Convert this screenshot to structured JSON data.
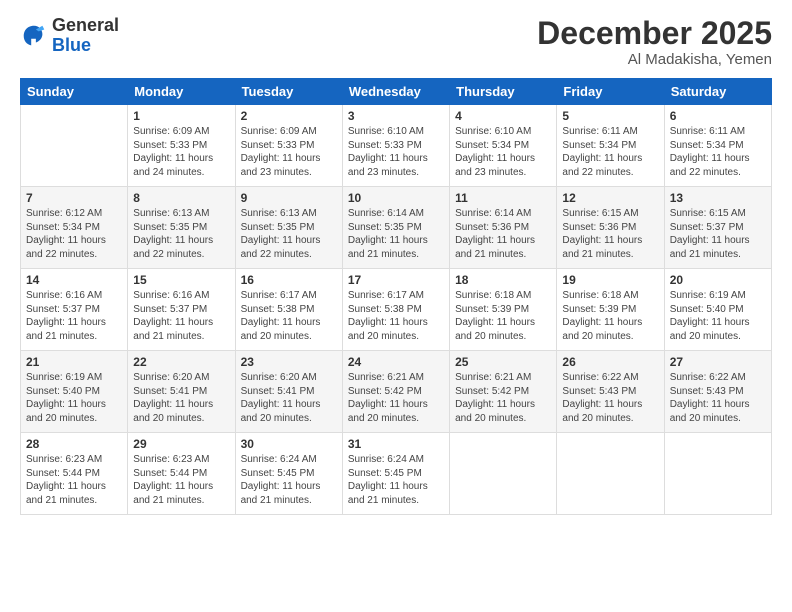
{
  "header": {
    "logo_general": "General",
    "logo_blue": "Blue",
    "month_title": "December 2025",
    "location": "Al Madakisha, Yemen"
  },
  "days_of_week": [
    "Sunday",
    "Monday",
    "Tuesday",
    "Wednesday",
    "Thursday",
    "Friday",
    "Saturday"
  ],
  "weeks": [
    [
      {
        "num": "",
        "sunrise": "",
        "sunset": "",
        "daylight": ""
      },
      {
        "num": "1",
        "sunrise": "Sunrise: 6:09 AM",
        "sunset": "Sunset: 5:33 PM",
        "daylight": "Daylight: 11 hours and 24 minutes."
      },
      {
        "num": "2",
        "sunrise": "Sunrise: 6:09 AM",
        "sunset": "Sunset: 5:33 PM",
        "daylight": "Daylight: 11 hours and 23 minutes."
      },
      {
        "num": "3",
        "sunrise": "Sunrise: 6:10 AM",
        "sunset": "Sunset: 5:33 PM",
        "daylight": "Daylight: 11 hours and 23 minutes."
      },
      {
        "num": "4",
        "sunrise": "Sunrise: 6:10 AM",
        "sunset": "Sunset: 5:34 PM",
        "daylight": "Daylight: 11 hours and 23 minutes."
      },
      {
        "num": "5",
        "sunrise": "Sunrise: 6:11 AM",
        "sunset": "Sunset: 5:34 PM",
        "daylight": "Daylight: 11 hours and 22 minutes."
      },
      {
        "num": "6",
        "sunrise": "Sunrise: 6:11 AM",
        "sunset": "Sunset: 5:34 PM",
        "daylight": "Daylight: 11 hours and 22 minutes."
      }
    ],
    [
      {
        "num": "7",
        "sunrise": "Sunrise: 6:12 AM",
        "sunset": "Sunset: 5:34 PM",
        "daylight": "Daylight: 11 hours and 22 minutes."
      },
      {
        "num": "8",
        "sunrise": "Sunrise: 6:13 AM",
        "sunset": "Sunset: 5:35 PM",
        "daylight": "Daylight: 11 hours and 22 minutes."
      },
      {
        "num": "9",
        "sunrise": "Sunrise: 6:13 AM",
        "sunset": "Sunset: 5:35 PM",
        "daylight": "Daylight: 11 hours and 22 minutes."
      },
      {
        "num": "10",
        "sunrise": "Sunrise: 6:14 AM",
        "sunset": "Sunset: 5:35 PM",
        "daylight": "Daylight: 11 hours and 21 minutes."
      },
      {
        "num": "11",
        "sunrise": "Sunrise: 6:14 AM",
        "sunset": "Sunset: 5:36 PM",
        "daylight": "Daylight: 11 hours and 21 minutes."
      },
      {
        "num": "12",
        "sunrise": "Sunrise: 6:15 AM",
        "sunset": "Sunset: 5:36 PM",
        "daylight": "Daylight: 11 hours and 21 minutes."
      },
      {
        "num": "13",
        "sunrise": "Sunrise: 6:15 AM",
        "sunset": "Sunset: 5:37 PM",
        "daylight": "Daylight: 11 hours and 21 minutes."
      }
    ],
    [
      {
        "num": "14",
        "sunrise": "Sunrise: 6:16 AM",
        "sunset": "Sunset: 5:37 PM",
        "daylight": "Daylight: 11 hours and 21 minutes."
      },
      {
        "num": "15",
        "sunrise": "Sunrise: 6:16 AM",
        "sunset": "Sunset: 5:37 PM",
        "daylight": "Daylight: 11 hours and 21 minutes."
      },
      {
        "num": "16",
        "sunrise": "Sunrise: 6:17 AM",
        "sunset": "Sunset: 5:38 PM",
        "daylight": "Daylight: 11 hours and 20 minutes."
      },
      {
        "num": "17",
        "sunrise": "Sunrise: 6:17 AM",
        "sunset": "Sunset: 5:38 PM",
        "daylight": "Daylight: 11 hours and 20 minutes."
      },
      {
        "num": "18",
        "sunrise": "Sunrise: 6:18 AM",
        "sunset": "Sunset: 5:39 PM",
        "daylight": "Daylight: 11 hours and 20 minutes."
      },
      {
        "num": "19",
        "sunrise": "Sunrise: 6:18 AM",
        "sunset": "Sunset: 5:39 PM",
        "daylight": "Daylight: 11 hours and 20 minutes."
      },
      {
        "num": "20",
        "sunrise": "Sunrise: 6:19 AM",
        "sunset": "Sunset: 5:40 PM",
        "daylight": "Daylight: 11 hours and 20 minutes."
      }
    ],
    [
      {
        "num": "21",
        "sunrise": "Sunrise: 6:19 AM",
        "sunset": "Sunset: 5:40 PM",
        "daylight": "Daylight: 11 hours and 20 minutes."
      },
      {
        "num": "22",
        "sunrise": "Sunrise: 6:20 AM",
        "sunset": "Sunset: 5:41 PM",
        "daylight": "Daylight: 11 hours and 20 minutes."
      },
      {
        "num": "23",
        "sunrise": "Sunrise: 6:20 AM",
        "sunset": "Sunset: 5:41 PM",
        "daylight": "Daylight: 11 hours and 20 minutes."
      },
      {
        "num": "24",
        "sunrise": "Sunrise: 6:21 AM",
        "sunset": "Sunset: 5:42 PM",
        "daylight": "Daylight: 11 hours and 20 minutes."
      },
      {
        "num": "25",
        "sunrise": "Sunrise: 6:21 AM",
        "sunset": "Sunset: 5:42 PM",
        "daylight": "Daylight: 11 hours and 20 minutes."
      },
      {
        "num": "26",
        "sunrise": "Sunrise: 6:22 AM",
        "sunset": "Sunset: 5:43 PM",
        "daylight": "Daylight: 11 hours and 20 minutes."
      },
      {
        "num": "27",
        "sunrise": "Sunrise: 6:22 AM",
        "sunset": "Sunset: 5:43 PM",
        "daylight": "Daylight: 11 hours and 20 minutes."
      }
    ],
    [
      {
        "num": "28",
        "sunrise": "Sunrise: 6:23 AM",
        "sunset": "Sunset: 5:44 PM",
        "daylight": "Daylight: 11 hours and 21 minutes."
      },
      {
        "num": "29",
        "sunrise": "Sunrise: 6:23 AM",
        "sunset": "Sunset: 5:44 PM",
        "daylight": "Daylight: 11 hours and 21 minutes."
      },
      {
        "num": "30",
        "sunrise": "Sunrise: 6:24 AM",
        "sunset": "Sunset: 5:45 PM",
        "daylight": "Daylight: 11 hours and 21 minutes."
      },
      {
        "num": "31",
        "sunrise": "Sunrise: 6:24 AM",
        "sunset": "Sunset: 5:45 PM",
        "daylight": "Daylight: 11 hours and 21 minutes."
      },
      {
        "num": "",
        "sunrise": "",
        "sunset": "",
        "daylight": ""
      },
      {
        "num": "",
        "sunrise": "",
        "sunset": "",
        "daylight": ""
      },
      {
        "num": "",
        "sunrise": "",
        "sunset": "",
        "daylight": ""
      }
    ]
  ]
}
